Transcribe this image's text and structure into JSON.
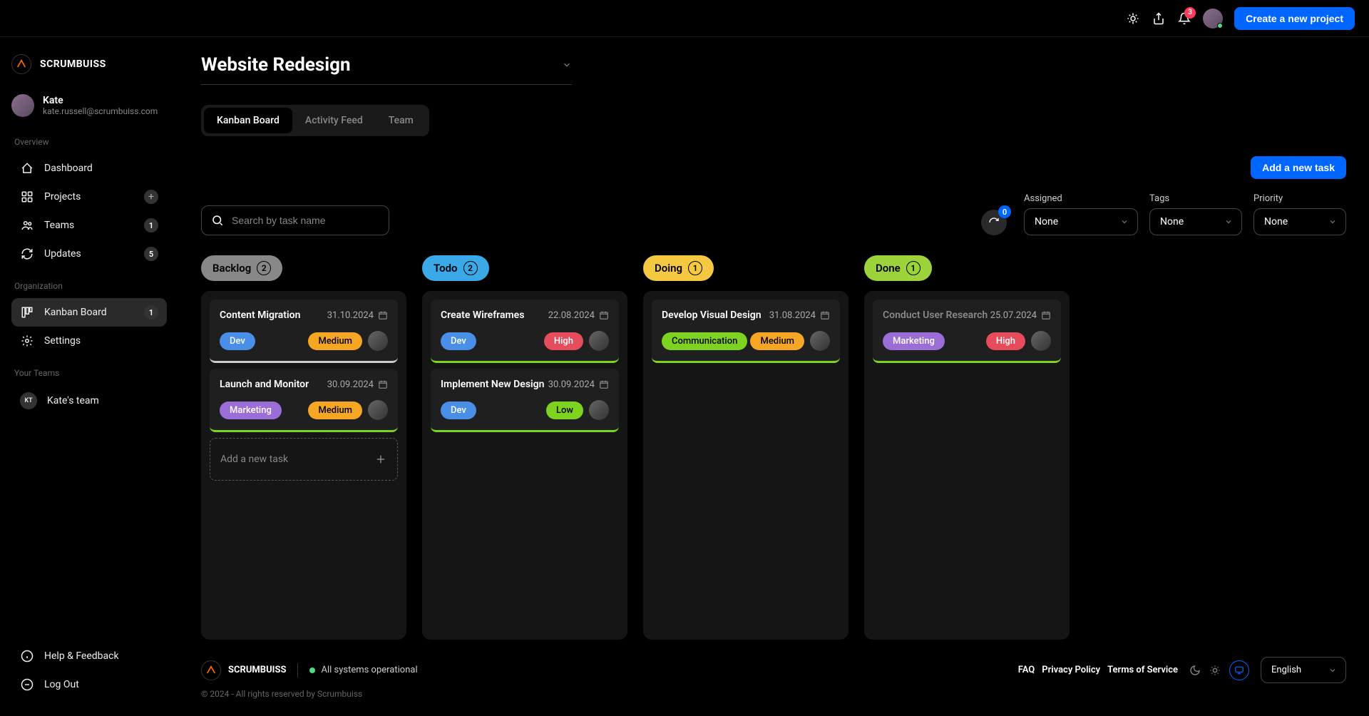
{
  "header": {
    "notif_count": "3",
    "create_project": "Create a new project"
  },
  "brand": "SCRUMBUISS",
  "user": {
    "name": "Kate",
    "email": "kate.russell@scrumbuiss.com"
  },
  "sections": {
    "overview": "Overview",
    "organization": "Organization",
    "your_teams": "Your Teams"
  },
  "nav": {
    "dashboard": "Dashboard",
    "projects": "Projects",
    "teams": "Teams",
    "teams_count": "1",
    "updates": "Updates",
    "updates_count": "5",
    "kanban": "Kanban Board",
    "kanban_count": "1",
    "settings": "Settings",
    "team1_initials": "KT",
    "team1_name": "Kate's team",
    "help": "Help & Feedback",
    "logout": "Log Out"
  },
  "page": {
    "title": "Website Redesign",
    "tabs": {
      "kanban": "Kanban Board",
      "activity": "Activity Feed",
      "team": "Team"
    },
    "add_task_btn": "Add a new task",
    "search_placeholder": "Search by task name",
    "refresh_count": "0",
    "filters": {
      "assigned": {
        "label": "Assigned",
        "value": "None"
      },
      "tags": {
        "label": "Tags",
        "value": "None"
      },
      "priority": {
        "label": "Priority",
        "value": "None"
      }
    }
  },
  "columns": {
    "backlog": {
      "label": "Backlog",
      "count": "2"
    },
    "todo": {
      "label": "Todo",
      "count": "2"
    },
    "doing": {
      "label": "Doing",
      "count": "1"
    },
    "done": {
      "label": "Done",
      "count": "1"
    }
  },
  "cards": {
    "b1": {
      "title": "Content Migration",
      "date": "31.10.2024",
      "tag": "Dev",
      "priority": "Medium"
    },
    "b2": {
      "title": "Launch and Monitor",
      "date": "30.09.2024",
      "tag": "Marketing",
      "priority": "Medium"
    },
    "t1": {
      "title": "Create Wireframes",
      "date": "22.08.2024",
      "tag": "Dev",
      "priority": "High"
    },
    "t2": {
      "title": "Implement New Design",
      "date": "30.09.2024",
      "tag": "Dev",
      "priority": "Low"
    },
    "d1": {
      "title": "Develop Visual Design",
      "date": "31.08.2024",
      "tag": "Communication",
      "priority": "Medium"
    },
    "dn1": {
      "title": "Conduct User Research",
      "date": "25.07.2024",
      "tag": "Marketing",
      "priority": "High"
    }
  },
  "add_task_label": "Add a new task",
  "footer": {
    "brand": "SCRUMBUISS",
    "status": "All systems operational",
    "faq": "FAQ",
    "privacy": "Privacy Policy",
    "tos": "Terms of Service",
    "language": "English",
    "copyright": "© 2024 - All rights reserved by Scrumbuiss"
  }
}
